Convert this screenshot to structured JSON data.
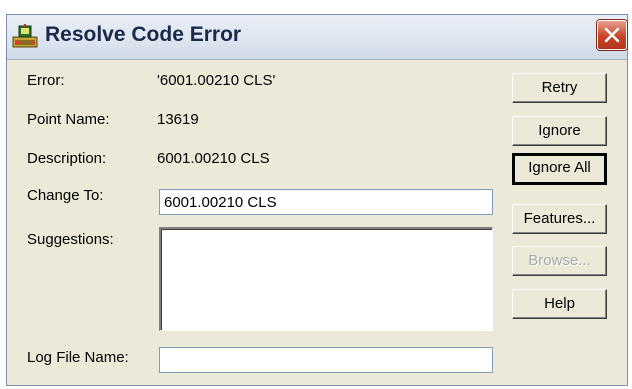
{
  "window": {
    "title": "Resolve Code Error"
  },
  "form": {
    "error_label": "Error:",
    "error_value": "'6001.00210 CLS'",
    "point_name_label": "Point Name:",
    "point_name_value": "13619",
    "description_label": "Description:",
    "description_value": "6001.00210 CLS",
    "change_to_label": "Change To:",
    "change_to_value": "6001.00210 CLS",
    "suggestions_label": "Suggestions:",
    "suggestions_items": [],
    "log_file_label": "Log File Name:",
    "log_file_value": ""
  },
  "buttons": {
    "retry": "Retry",
    "ignore": "Ignore",
    "ignore_all": "Ignore All",
    "features": "Features...",
    "browse": "Browse...",
    "help": "Help"
  },
  "states": {
    "default_button": "ignore_all",
    "browse_enabled": false
  },
  "icons": {
    "app": "app-icon",
    "close": "close-icon"
  },
  "colors": {
    "dialog_bg": "#ece9d8",
    "close_red": "#c8452c",
    "field_border": "#7f9db9"
  }
}
